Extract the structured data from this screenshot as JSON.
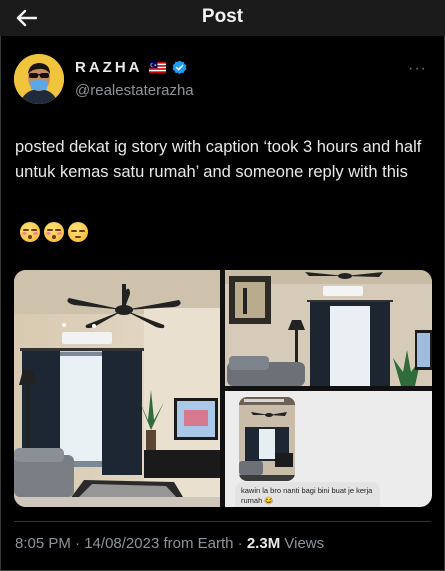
{
  "header": {
    "title": "Post",
    "back_icon": "arrow-left-icon"
  },
  "author": {
    "display_name": "RAZHA",
    "handle": "@realestaterazha",
    "flag_icon": "malaysia-flag-icon",
    "verified_icon": "verified-badge-icon",
    "verified_color": "#1d9bf0",
    "avatar_bg": "#f0c43c"
  },
  "more_label": "···",
  "tweet": {
    "text": "posted dekat ig story with caption ‘took 3 hours and half untuk kemas satu rumah’ and someone reply with this",
    "emojis": [
      "face-exhaling-emoji",
      "face-exhaling-emoji",
      "relieved-face-emoji"
    ]
  },
  "media": {
    "photos": [
      "living-room-photo",
      "living-room-corner-photo",
      "story-reply-screenshot"
    ],
    "reply_screenshot": {
      "header_text": "",
      "caption": "kawin la bro nanti bagi bini buat je kerja rumah 😂"
    }
  },
  "meta": {
    "time": "8:05 PM",
    "date": "14/08/2023",
    "source": "from Earth",
    "views_count": "2.3M",
    "views_label": "Views",
    "sep": "·"
  }
}
